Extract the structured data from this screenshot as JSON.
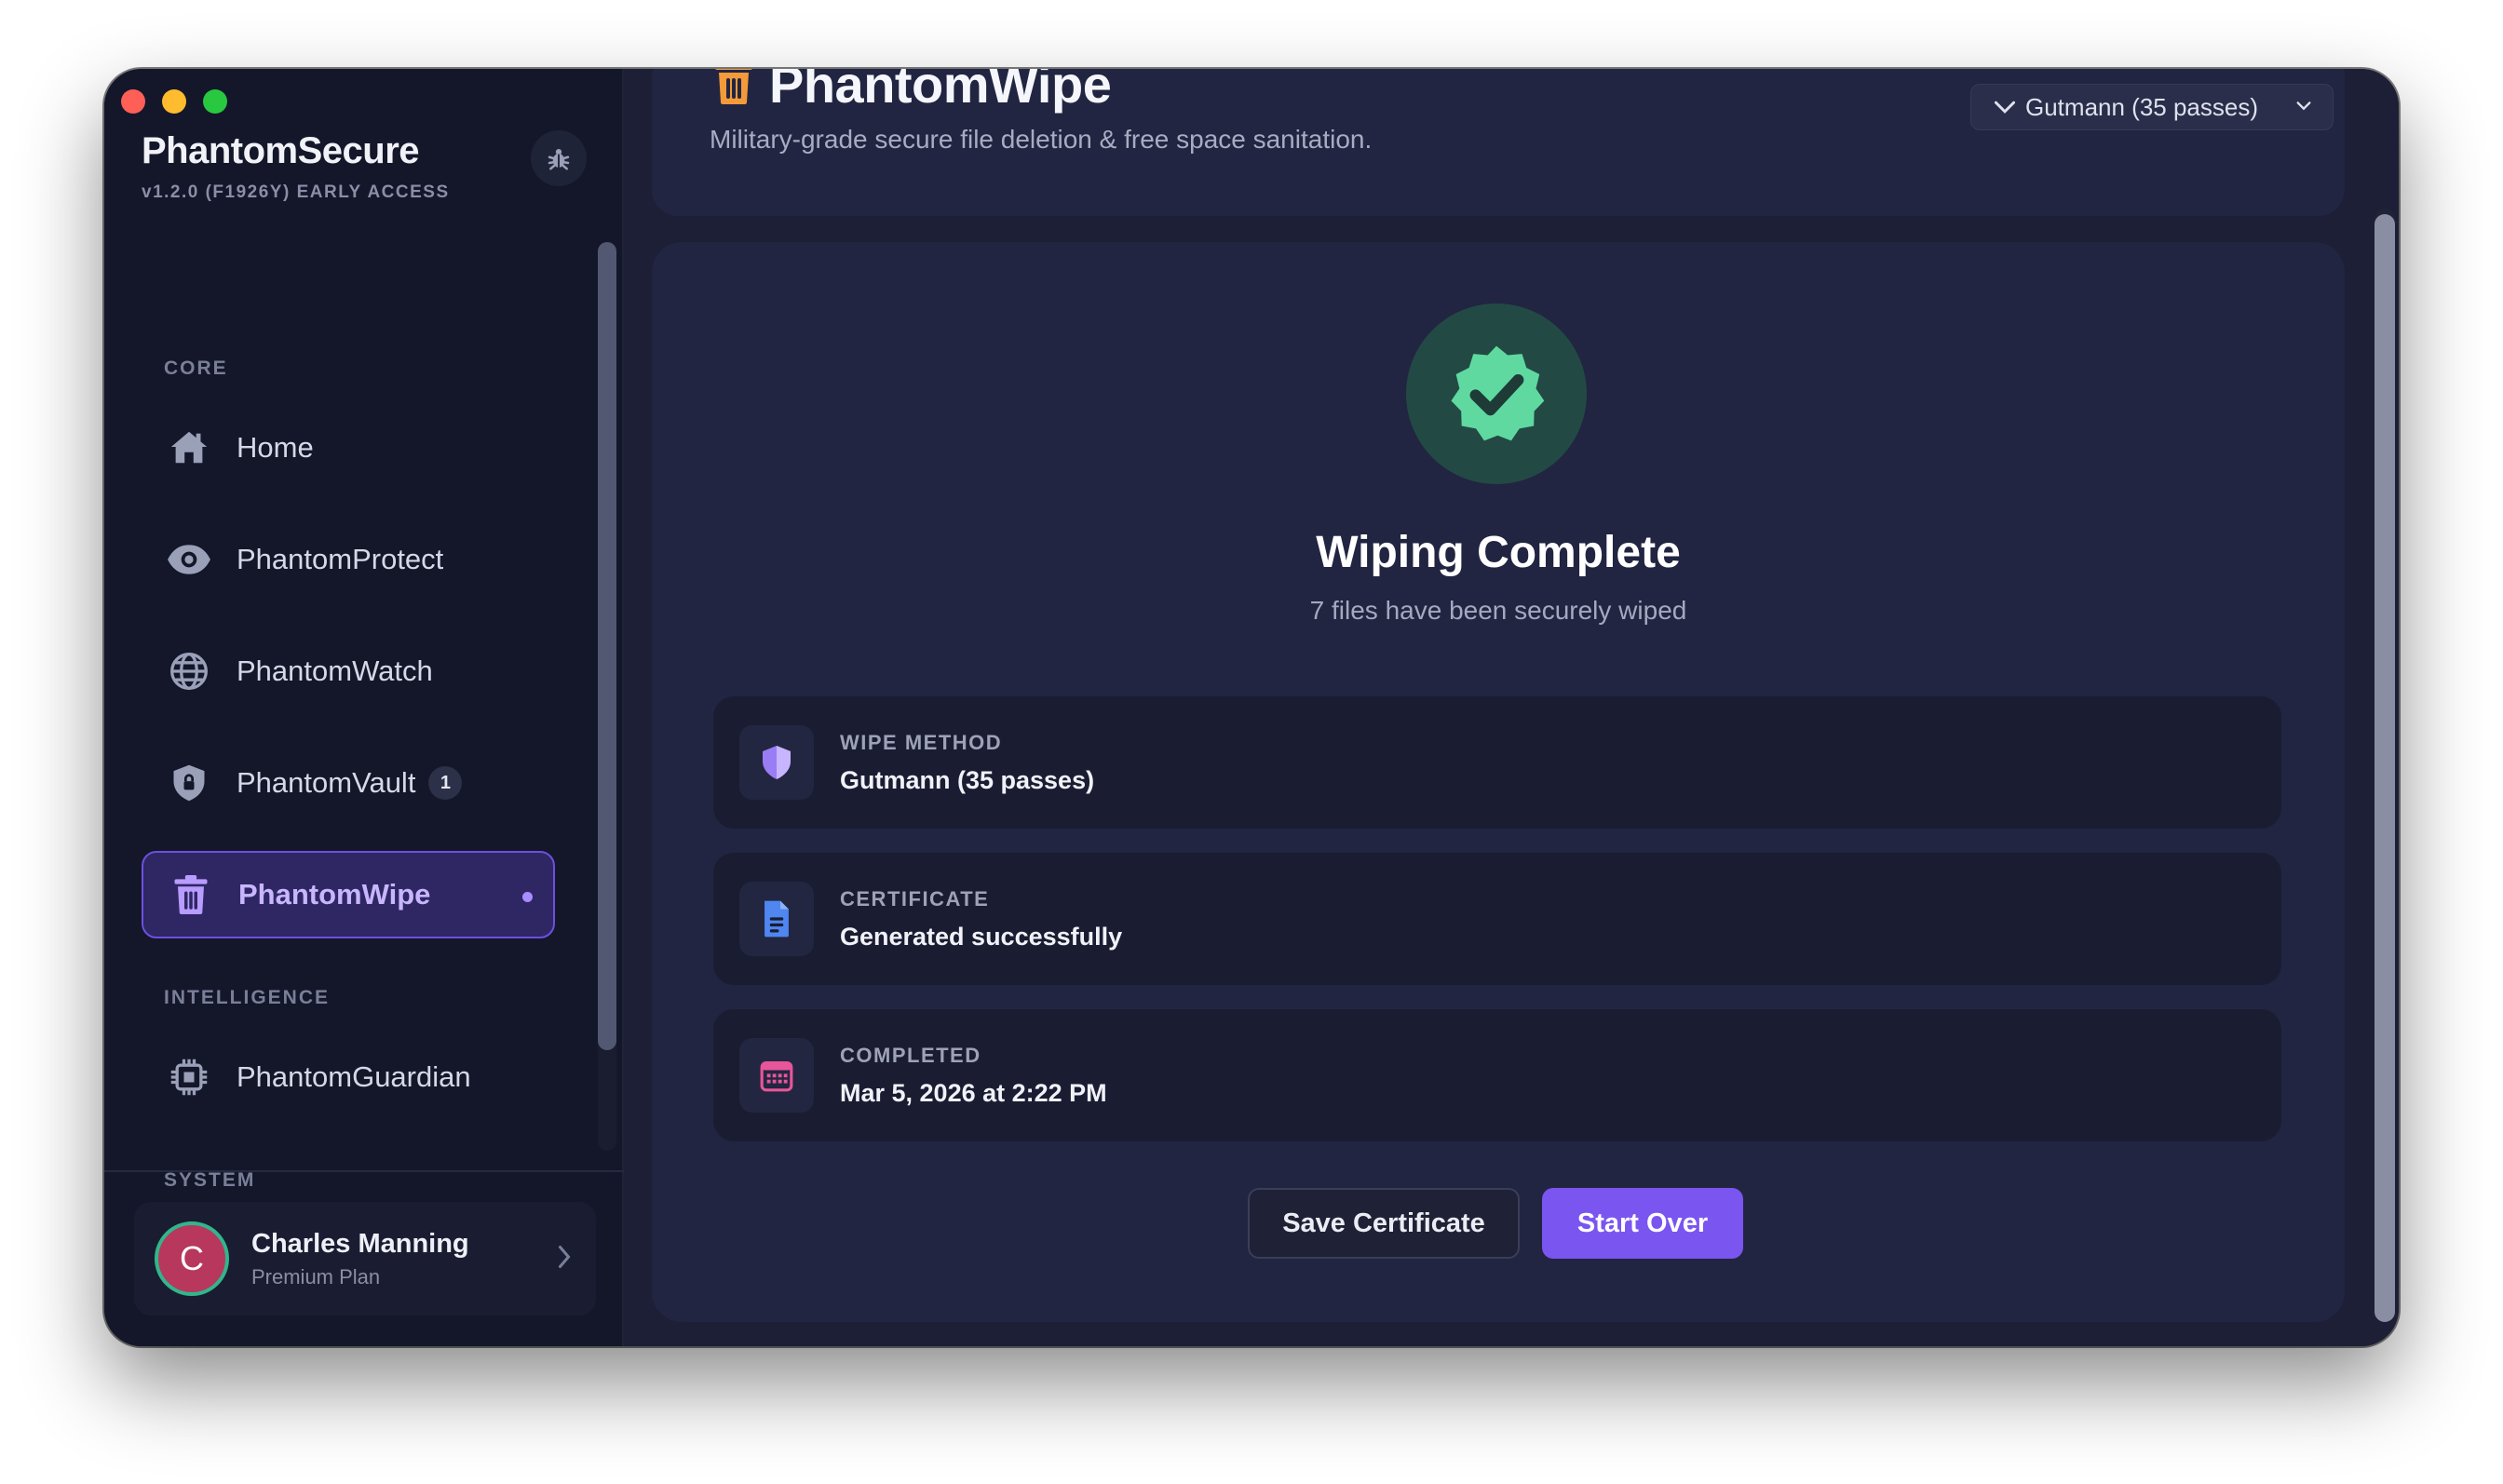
{
  "window": {
    "controls": [
      "close",
      "minimize",
      "zoom"
    ]
  },
  "sidebar": {
    "brand": "PhantomSecure",
    "version": "v1.2.0 (F1926Y) EARLY ACCESS",
    "bug_icon": "bug-icon",
    "sections": {
      "core": "CORE",
      "intelligence": "INTELLIGENCE",
      "system": "SYSTEM"
    },
    "items": [
      {
        "label": "Home",
        "icon": "home-icon"
      },
      {
        "label": "PhantomProtect",
        "icon": "eye-icon"
      },
      {
        "label": "PhantomWatch",
        "icon": "globe-icon"
      },
      {
        "label": "PhantomVault",
        "icon": "lock-shield-icon",
        "badge": "1"
      },
      {
        "label": "PhantomWipe",
        "icon": "trash-icon",
        "active": true
      },
      {
        "label": "PhantomGuardian",
        "icon": "chip-icon"
      }
    ],
    "user": {
      "initial": "C",
      "name": "Charles Manning",
      "plan": "Premium Plan"
    }
  },
  "header": {
    "title": "PhantomWipe",
    "subtitle": "Military-grade secure file deletion & free space sanitation.",
    "method_select": "Gutmann (35 passes)"
  },
  "result": {
    "title": "Wiping Complete",
    "subtitle": "7 files have been securely wiped",
    "rows": [
      {
        "label": "WIPE METHOD",
        "value": "Gutmann (35 passes)",
        "icon": "shield-icon"
      },
      {
        "label": "CERTIFICATE",
        "value": "Generated successfully",
        "icon": "document-icon"
      },
      {
        "label": "COMPLETED",
        "value": "Mar 5, 2026 at 2:22 PM",
        "icon": "calendar-icon"
      }
    ],
    "save_button": "Save Certificate",
    "start_over_button": "Start Over"
  },
  "colors": {
    "accent": "#7a55f0",
    "success": "#5fd9a0",
    "header_icon": "#f39a3b",
    "shield": "#9a7cf5",
    "document": "#4f86f0",
    "calendar": "#e8559a"
  }
}
